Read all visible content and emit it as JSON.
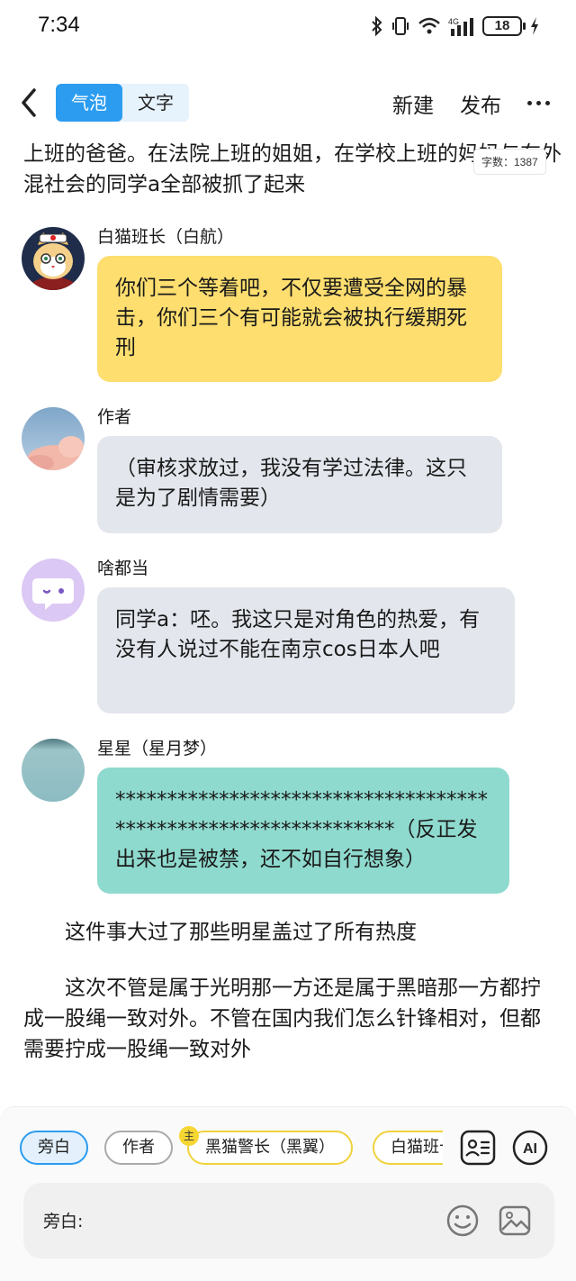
{
  "status_bar": {
    "time": "7:34",
    "battery": "18"
  },
  "header": {
    "tabs": [
      {
        "label": "气泡",
        "active": true
      },
      {
        "label": "文字",
        "active": false
      }
    ],
    "new_label": "新建",
    "publish_label": "发布"
  },
  "content": {
    "top_text": "上班的爸爸。在法院上班的姐姐，在学校上班的妈妈与在外混社会的同学a全部被抓了起来",
    "char_count": "字数：1387",
    "messages": [
      {
        "name": "白猫班长（白航）",
        "text": "你们三个等着吧，不仅要遭受全网的暴击，你们三个有可能就会被执行缓期死刑",
        "bubble_color": "#fdde6f"
      },
      {
        "name": "作者",
        "text": "（审核求放过，我没有学过法律。这只是为了剧情需要）",
        "bubble_color": "#e3e7ed"
      },
      {
        "name": "啥都当",
        "text": "同学a：呸。我这只是对角色的热爱，有没有人说过不能在南京cos日本人吧",
        "bubble_color": "#e3e7ed"
      },
      {
        "name": "星星（星月梦）",
        "text": "***************************************************************（反正发出来也是被禁，还不如自行想象）",
        "bubble_color": "#8fdace"
      }
    ],
    "paragraphs": [
      "这件事大过了那些明星盖过了所有热度",
      "这次不管是属于光明那一方还是属于黑暗那一方都拧成一股绳一致对外。不管在国内我们怎么针锋相对，但都需要拧成一股绳一致对外"
    ]
  },
  "bottom": {
    "chips": [
      {
        "label": "旁白",
        "selected": true
      },
      {
        "label": "作者",
        "selected": false
      },
      {
        "label": "黑猫警长（黑翼）",
        "selected": false,
        "badge": "主"
      },
      {
        "label": "白猫班长（白航）",
        "selected": false
      }
    ],
    "ai_label": "AI",
    "input_label": "旁白:"
  },
  "colors": {
    "accent": "#2b9cf0",
    "bubble_yellow": "#fdde6f",
    "bubble_gray": "#e3e7ed",
    "bubble_teal": "#8fdace"
  }
}
